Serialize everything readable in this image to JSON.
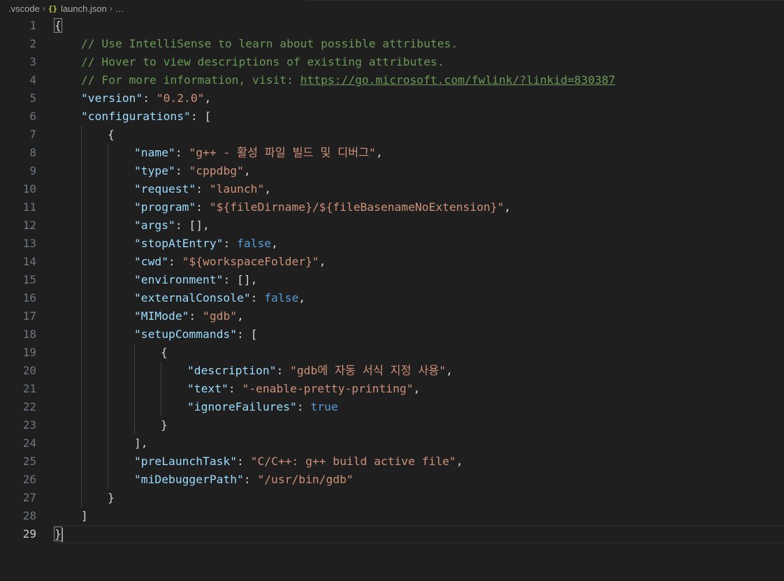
{
  "breadcrumb": {
    "folder": ".vscode",
    "file_icon": "{}",
    "file": "launch.json",
    "symbol": "…"
  },
  "editor": {
    "active_line": 29,
    "lines": [
      [
        {
          "t": "bracket",
          "v": "{"
        }
      ],
      [
        {
          "t": "com",
          "v": "// Use IntelliSense to learn about possible attributes."
        }
      ],
      [
        {
          "t": "com",
          "v": "// Hover to view descriptions of existing attributes."
        }
      ],
      [
        {
          "t": "com",
          "v": "// For more information, visit: "
        },
        {
          "t": "link",
          "v": "https://go.microsoft.com/fwlink/?linkid=830387"
        }
      ],
      [
        {
          "t": "key",
          "v": "\"version\""
        },
        {
          "t": "punc",
          "v": ": "
        },
        {
          "t": "str",
          "v": "\"0.2.0\""
        },
        {
          "t": "punc",
          "v": ","
        }
      ],
      [
        {
          "t": "key",
          "v": "\"configurations\""
        },
        {
          "t": "punc",
          "v": ": ["
        }
      ],
      [
        {
          "t": "punc",
          "v": "{"
        }
      ],
      [
        {
          "t": "key",
          "v": "\"name\""
        },
        {
          "t": "punc",
          "v": ": "
        },
        {
          "t": "str",
          "v": "\"g++ - 활성 파일 빌드 및 디버그\""
        },
        {
          "t": "punc",
          "v": ","
        }
      ],
      [
        {
          "t": "key",
          "v": "\"type\""
        },
        {
          "t": "punc",
          "v": ": "
        },
        {
          "t": "str",
          "v": "\"cppdbg\""
        },
        {
          "t": "punc",
          "v": ","
        }
      ],
      [
        {
          "t": "key",
          "v": "\"request\""
        },
        {
          "t": "punc",
          "v": ": "
        },
        {
          "t": "str",
          "v": "\"launch\""
        },
        {
          "t": "punc",
          "v": ","
        }
      ],
      [
        {
          "t": "key",
          "v": "\"program\""
        },
        {
          "t": "punc",
          "v": ": "
        },
        {
          "t": "str",
          "v": "\"${fileDirname}/${fileBasenameNoExtension}\""
        },
        {
          "t": "punc",
          "v": ","
        }
      ],
      [
        {
          "t": "key",
          "v": "\"args\""
        },
        {
          "t": "punc",
          "v": ": [],"
        }
      ],
      [
        {
          "t": "key",
          "v": "\"stopAtEntry\""
        },
        {
          "t": "punc",
          "v": ": "
        },
        {
          "t": "bool",
          "v": "false"
        },
        {
          "t": "punc",
          "v": ","
        }
      ],
      [
        {
          "t": "key",
          "v": "\"cwd\""
        },
        {
          "t": "punc",
          "v": ": "
        },
        {
          "t": "str",
          "v": "\"${workspaceFolder}\""
        },
        {
          "t": "punc",
          "v": ","
        }
      ],
      [
        {
          "t": "key",
          "v": "\"environment\""
        },
        {
          "t": "punc",
          "v": ": [],"
        }
      ],
      [
        {
          "t": "key",
          "v": "\"externalConsole\""
        },
        {
          "t": "punc",
          "v": ": "
        },
        {
          "t": "bool",
          "v": "false"
        },
        {
          "t": "punc",
          "v": ","
        }
      ],
      [
        {
          "t": "key",
          "v": "\"MIMode\""
        },
        {
          "t": "punc",
          "v": ": "
        },
        {
          "t": "str",
          "v": "\"gdb\""
        },
        {
          "t": "punc",
          "v": ","
        }
      ],
      [
        {
          "t": "key",
          "v": "\"setupCommands\""
        },
        {
          "t": "punc",
          "v": ": ["
        }
      ],
      [
        {
          "t": "punc",
          "v": "{"
        }
      ],
      [
        {
          "t": "key",
          "v": "\"description\""
        },
        {
          "t": "punc",
          "v": ": "
        },
        {
          "t": "str",
          "v": "\"gdb에 자동 서식 지정 사용\""
        },
        {
          "t": "punc",
          "v": ","
        }
      ],
      [
        {
          "t": "key",
          "v": "\"text\""
        },
        {
          "t": "punc",
          "v": ": "
        },
        {
          "t": "str",
          "v": "\"-enable-pretty-printing\""
        },
        {
          "t": "punc",
          "v": ","
        }
      ],
      [
        {
          "t": "key",
          "v": "\"ignoreFailures\""
        },
        {
          "t": "punc",
          "v": ": "
        },
        {
          "t": "bool",
          "v": "true"
        }
      ],
      [
        {
          "t": "punc",
          "v": "}"
        }
      ],
      [
        {
          "t": "punc",
          "v": "],"
        }
      ],
      [
        {
          "t": "key",
          "v": "\"preLaunchTask\""
        },
        {
          "t": "punc",
          "v": ": "
        },
        {
          "t": "str",
          "v": "\"C/C++: g++ build active file\""
        },
        {
          "t": "punc",
          "v": ","
        }
      ],
      [
        {
          "t": "key",
          "v": "\"miDebuggerPath\""
        },
        {
          "t": "punc",
          "v": ": "
        },
        {
          "t": "str",
          "v": "\"/usr/bin/gdb\""
        }
      ],
      [
        {
          "t": "punc",
          "v": "}"
        }
      ],
      [
        {
          "t": "punc",
          "v": "]"
        }
      ],
      [
        {
          "t": "bracket",
          "v": "}"
        }
      ]
    ]
  }
}
